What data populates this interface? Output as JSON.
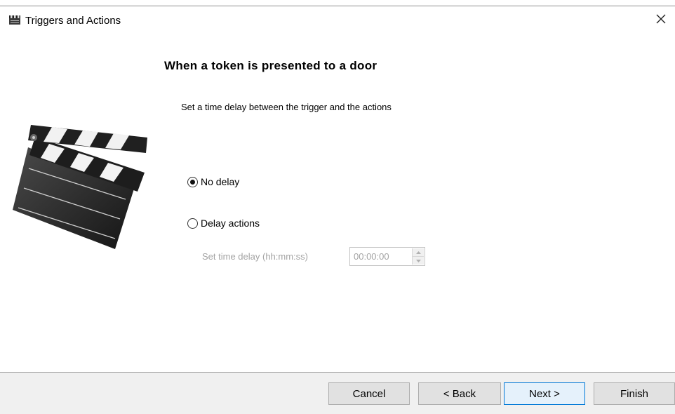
{
  "window": {
    "title": "Triggers and Actions",
    "close_label": "×"
  },
  "page": {
    "heading": "When a token is presented to a door",
    "subtitle": "Set a time delay between the trigger and the actions"
  },
  "options": {
    "no_delay": {
      "label": "No delay",
      "selected": true
    },
    "delay_actions": {
      "label": "Delay actions",
      "selected": false
    }
  },
  "delay": {
    "label": "Set time delay (hh:mm:ss)",
    "value": "00:00:00"
  },
  "buttons": {
    "cancel": "Cancel",
    "back": "< Back",
    "next": "Next >",
    "finish": "Finish"
  },
  "icons": {
    "app": "clapperboard-icon",
    "illustration": "clapperboard-illustration"
  },
  "colors": {
    "accent": "#0078d7",
    "disabled_text": "#a3a3a3",
    "footer_bg": "#f0f0f0"
  }
}
